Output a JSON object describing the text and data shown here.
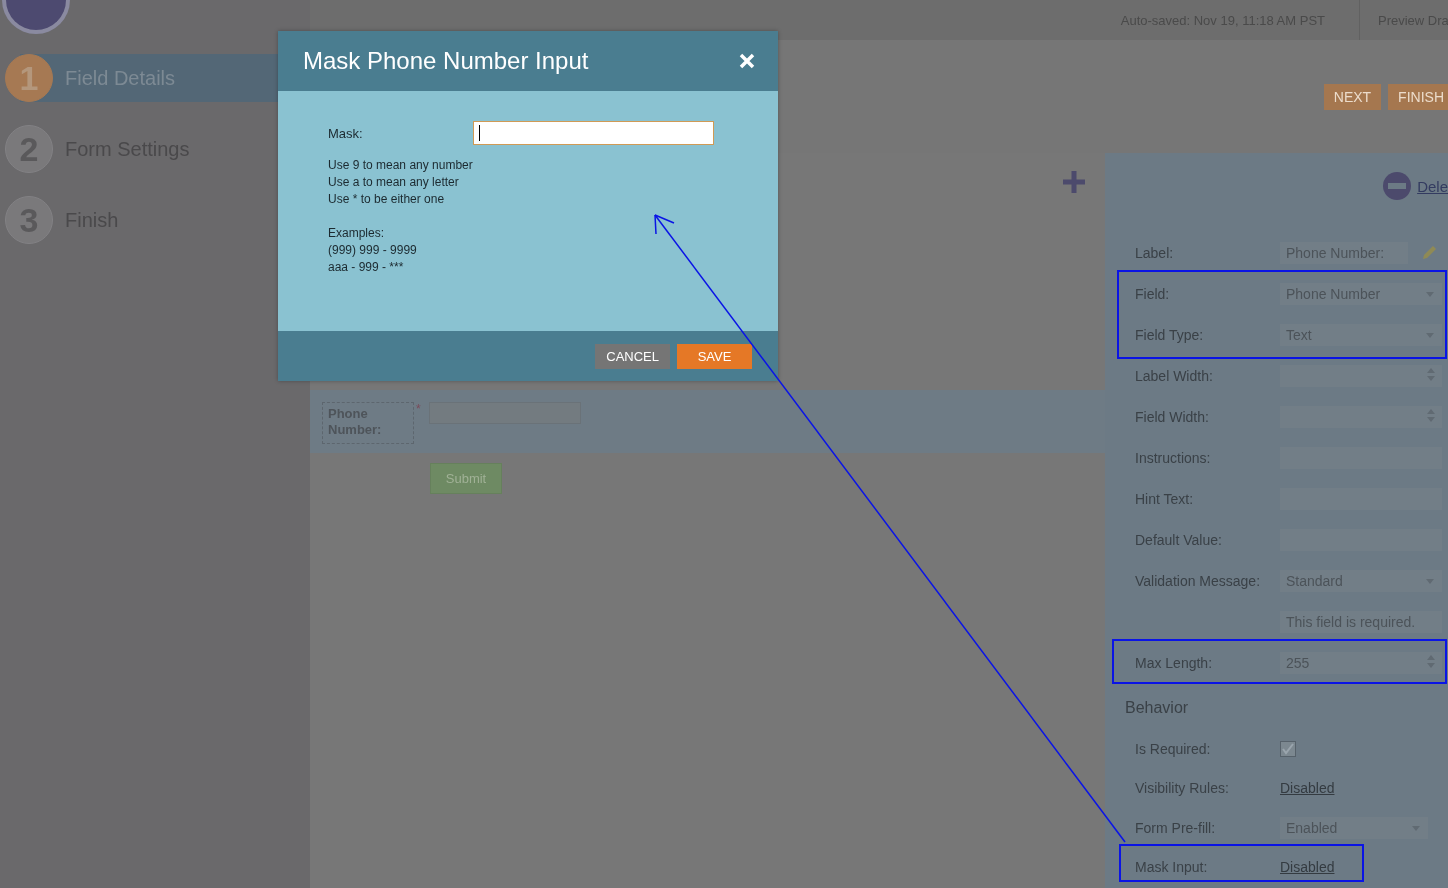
{
  "sidebar": {
    "steps": [
      {
        "number": "1",
        "label": "Field Details",
        "selected": true
      },
      {
        "number": "2",
        "label": "Form Settings",
        "selected": false
      },
      {
        "number": "3",
        "label": "Finish",
        "selected": false
      }
    ]
  },
  "top_bar": {
    "autosave": "Auto-saved: Nov 19, 11:18 AM PST",
    "preview": "Preview Dra"
  },
  "header": {
    "buttons": [
      "NEXT",
      "FINISH"
    ]
  },
  "canvas": {
    "field_label": "Phone Number:",
    "required_mark": "*",
    "submit": "Submit"
  },
  "properties": {
    "delete": "Dele",
    "rows": [
      {
        "kind": "text",
        "label": "Label:",
        "value": "Phone Number:",
        "editable": true
      },
      {
        "kind": "select",
        "label": "Field:",
        "value": "Phone Number"
      },
      {
        "kind": "select",
        "label": "Field Type:",
        "value": "Text"
      },
      {
        "kind": "spinner",
        "label": "Label Width:",
        "value": ""
      },
      {
        "kind": "spinner",
        "label": "Field Width:",
        "value": ""
      },
      {
        "kind": "text",
        "label": "Instructions:",
        "value": ""
      },
      {
        "kind": "text",
        "label": "Hint Text:",
        "value": ""
      },
      {
        "kind": "text",
        "label": "Default Value:",
        "value": ""
      },
      {
        "kind": "select",
        "label": "Validation Message:",
        "value": "Standard"
      },
      {
        "kind": "text",
        "label": "",
        "value": "This field is required."
      },
      {
        "kind": "spinner",
        "label": "Max Length:",
        "value": "255"
      }
    ],
    "behavior_title": "Behavior",
    "behavior": [
      {
        "kind": "check",
        "label": "Is Required:",
        "checked": true
      },
      {
        "kind": "link",
        "label": "Visibility Rules:",
        "value": "Disabled"
      },
      {
        "kind": "select",
        "label": "Form Pre-fill:",
        "value": "Enabled"
      },
      {
        "kind": "link",
        "label": "Mask Input:",
        "value": "Disabled"
      }
    ]
  },
  "dialog": {
    "title": "Mask Phone Number Input",
    "mask_label": "Mask:",
    "help": [
      "Use 9 to mean any number",
      "Use a to mean any letter",
      "Use * to be either one"
    ],
    "examples_title": "Examples:",
    "examples": [
      "(999) 999 - 9999",
      "aaa - 999 - ***"
    ],
    "buttons": [
      {
        "label": "CANCEL",
        "kind": "secondary"
      },
      {
        "label": "SAVE",
        "kind": "primary"
      }
    ]
  }
}
